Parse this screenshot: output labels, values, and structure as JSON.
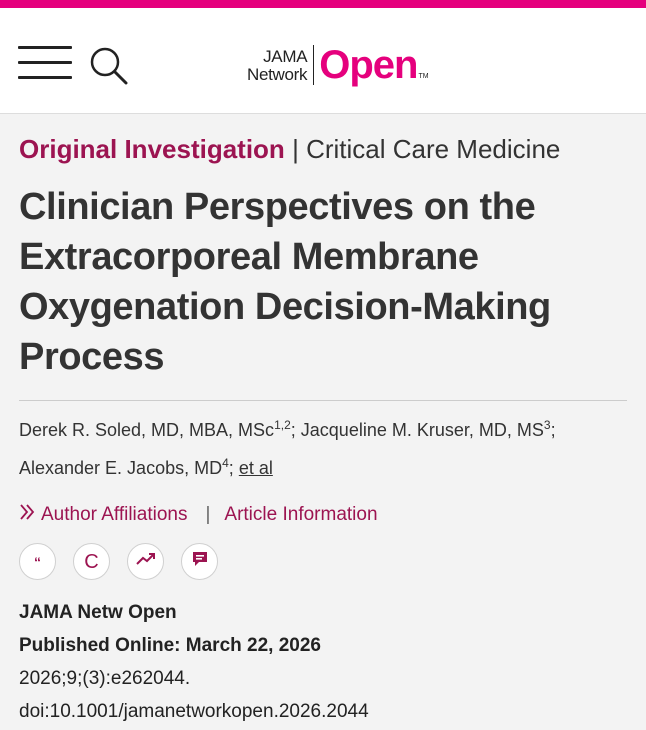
{
  "colors": {
    "brand": "#e5007d",
    "link": "#9c1451",
    "text": "#333333"
  },
  "logo": {
    "small_line1": "JAMA",
    "small_line2": "Network",
    "big": "Open",
    "tm": "TM"
  },
  "header": {
    "menu_icon": "menu-icon",
    "search_icon": "search-icon"
  },
  "article": {
    "type": "Original Investigation",
    "separator": "|",
    "specialty": "Critical Care Medicine",
    "title": "Clinician Perspectives on the Extracorporeal Membrane Oxygenation Decision-Making Process",
    "authors": [
      {
        "name": "Derek R. Soled, MD, MBA, MSc",
        "sup": "1,2",
        "after": ";"
      },
      {
        "name": "Jacqueline M. Kruser, MD, MS",
        "sup": "3",
        "after": ";"
      },
      {
        "name": "Alexander E. Jacobs, MD",
        "sup": "4",
        "after": ";"
      }
    ],
    "et_al": "et al",
    "author_affiliations": "Author Affiliations",
    "links_separator": "|",
    "article_information": "Article Information",
    "tool_icons": [
      {
        "name": "cite-quote-icon",
        "glyph": "❝"
      },
      {
        "name": "copyright-c-icon",
        "glyph": "C"
      },
      {
        "name": "metrics-trend-icon",
        "glyph": ""
      },
      {
        "name": "comment-icon",
        "glyph": ""
      }
    ],
    "journal": "JAMA Netw Open",
    "published": "Published Online: March 22, 2026",
    "citation": "2026;9;(3):e262044.",
    "doi": "doi:10.1001/jamanetworkopen.2026.2044"
  }
}
